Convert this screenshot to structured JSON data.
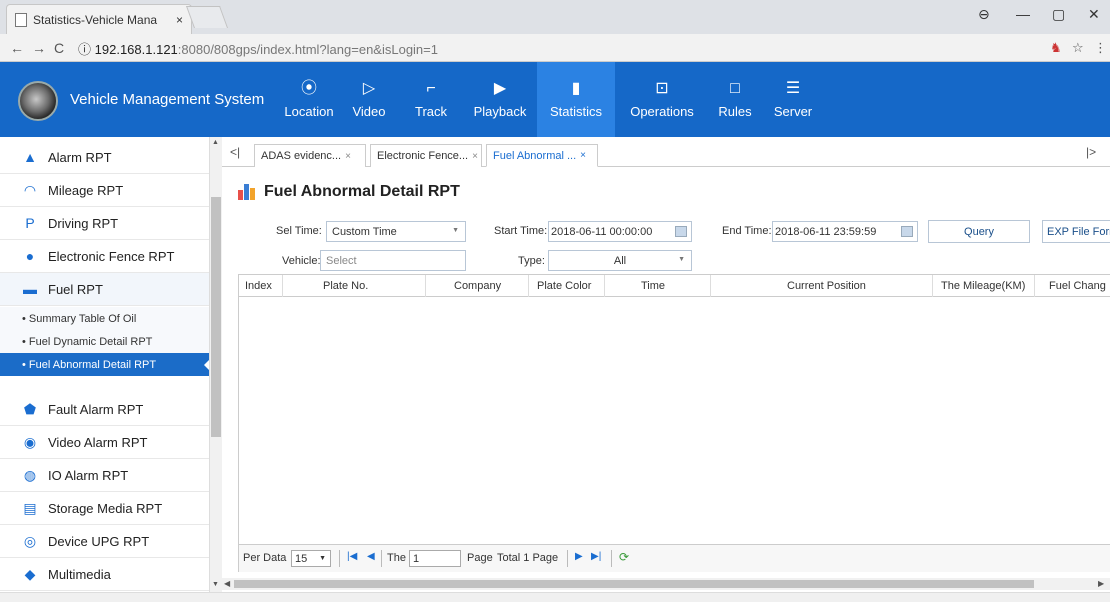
{
  "browser": {
    "tab_title": "Statistics-Vehicle Mana",
    "tab_close": "×",
    "url_host": "192.168.1.121",
    "url_path": ":8080/808gps/index.html?lang=en&isLogin=1",
    "back": "←",
    "forward": "→",
    "reload": "C",
    "info": "ⓘ",
    "star": "☆",
    "menu": "⋮",
    "account": "⊖",
    "minimize": "—",
    "restore": "▢",
    "close": "✕"
  },
  "app": {
    "name": "Vehicle Management System",
    "accent": "#1568c8",
    "active_menu_color": "#2b82e3",
    "menu": [
      {
        "label": "Location",
        "icon": "⦿"
      },
      {
        "label": "Video",
        "icon": "▷"
      },
      {
        "label": "Track",
        "icon": "⌐"
      },
      {
        "label": "Playback",
        "icon": "▶"
      },
      {
        "label": "Statistics",
        "icon": "▮"
      },
      {
        "label": "Operations",
        "icon": "⊡"
      },
      {
        "label": "Rules",
        "icon": "□"
      },
      {
        "label": "Server",
        "icon": "☰"
      }
    ]
  },
  "sidebar": {
    "items": [
      {
        "label": "Alarm RPT",
        "icon": "▲"
      },
      {
        "label": "Mileage RPT",
        "icon": "◠"
      },
      {
        "label": "Driving RPT",
        "icon": "P"
      },
      {
        "label": "Electronic Fence RPT",
        "icon": "●"
      },
      {
        "label": "Fuel RPT",
        "icon": "▬"
      },
      {
        "label": "Fault Alarm RPT",
        "icon": "⬟"
      },
      {
        "label": "Video Alarm RPT",
        "icon": "◉"
      },
      {
        "label": "IO Alarm RPT",
        "icon": "◍"
      },
      {
        "label": "Storage Media RPT",
        "icon": "▤"
      },
      {
        "label": "Device UPG RPT",
        "icon": "◎"
      },
      {
        "label": "Multimedia",
        "icon": "◆"
      }
    ],
    "sub_items": [
      {
        "label": "Summary Table Of Oil"
      },
      {
        "label": "Fuel Dynamic Detail RPT"
      },
      {
        "label": "Fuel Abnormal Detail RPT"
      }
    ]
  },
  "tabs": {
    "prev": "<|",
    "next": "|>",
    "items": [
      {
        "label": "ADAS evidenc...",
        "close": "×"
      },
      {
        "label": "Electronic Fence...",
        "close": "×"
      },
      {
        "label": "Fuel Abnormal ...",
        "close": "×"
      }
    ]
  },
  "page": {
    "title": "Fuel Abnormal Detail RPT",
    "chart_icon_colors": [
      "#e8504a",
      "#3a7ed4",
      "#f2a32b"
    ]
  },
  "filters": {
    "sel_time_label": "Sel Time:",
    "sel_time_value": "Custom Time",
    "start_time_label": "Start Time:",
    "start_time_value": "2018-06-11 00:00:00",
    "end_time_label": "End Time:",
    "end_time_value": "2018-06-11 23:59:59",
    "query_button": "Query",
    "export_button": "EXP File Form",
    "vehicle_label": "Vehicle:",
    "vehicle_placeholder": "Select",
    "type_label": "Type:",
    "type_value": "All"
  },
  "table": {
    "columns": [
      "Index",
      "Plate No.",
      "Company",
      "Plate Color",
      "Time",
      "Current Position",
      "The Mileage(KM)",
      "Fuel Chang"
    ]
  },
  "pager": {
    "per_data_label": "Per Data",
    "per_data_value": "15",
    "the_label": "The",
    "page_value": "1",
    "page_label": "Page",
    "total_label": "Total 1 Page"
  }
}
